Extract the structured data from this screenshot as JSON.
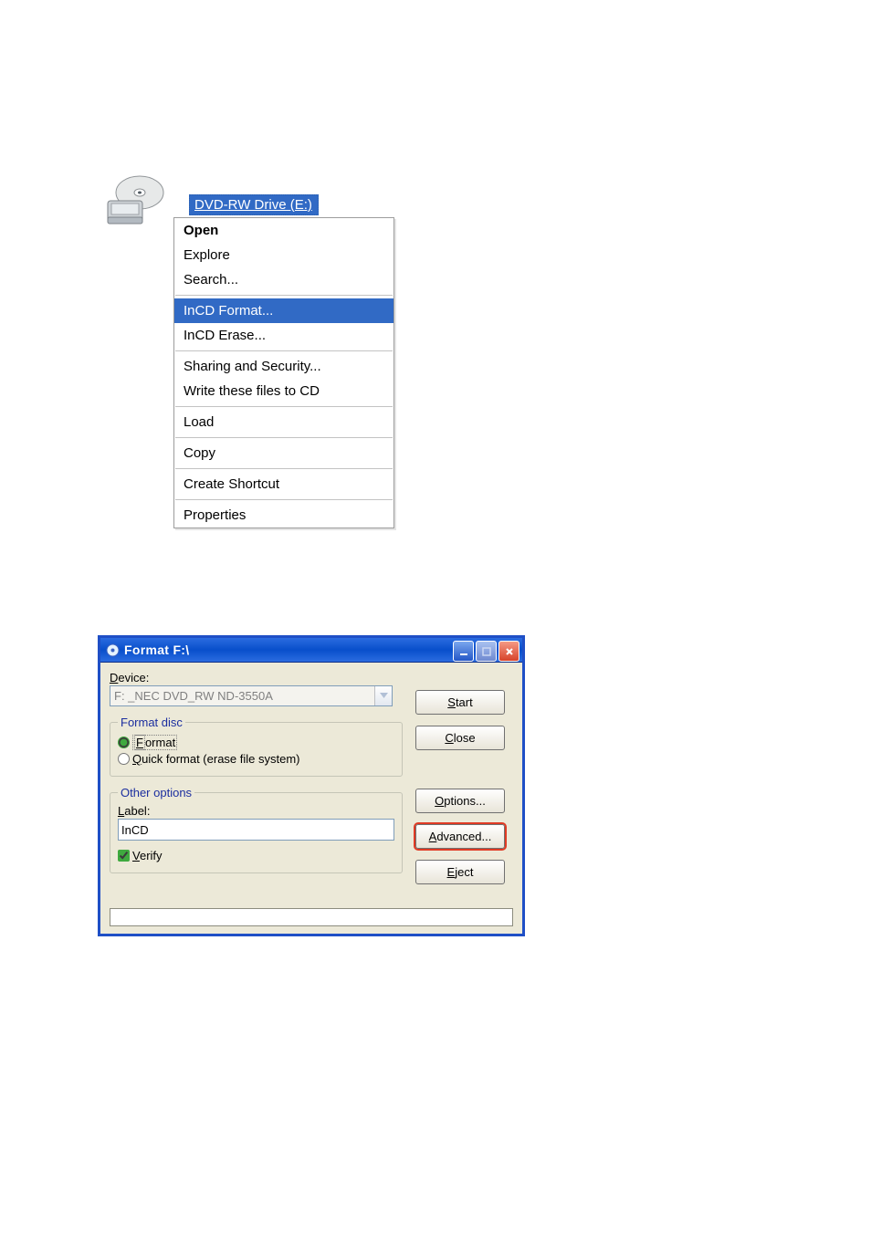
{
  "drive": {
    "title": "DVD-RW Drive (E:)"
  },
  "context_menu": {
    "items": [
      {
        "label": "Open",
        "kind": "bold"
      },
      {
        "label": "Explore"
      },
      {
        "label": "Search..."
      },
      {
        "kind": "sep"
      },
      {
        "label": "InCD Format...",
        "kind": "highlight"
      },
      {
        "label": "InCD Erase..."
      },
      {
        "kind": "sep"
      },
      {
        "label": "Sharing and Security..."
      },
      {
        "label": "Write these files to CD"
      },
      {
        "kind": "sep"
      },
      {
        "label": "Load"
      },
      {
        "kind": "sep"
      },
      {
        "label": "Copy"
      },
      {
        "kind": "sep"
      },
      {
        "label": "Create Shortcut"
      },
      {
        "kind": "sep"
      },
      {
        "label": "Properties"
      }
    ]
  },
  "dialog": {
    "title": "Format F:\\",
    "device_label": "Device:",
    "device_value": "F: _NEC DVD_RW ND-3550A",
    "format_disc": {
      "legend": "Format disc",
      "radio_format": "Format",
      "radio_quick": "Quick format (erase file system)"
    },
    "other_options": {
      "legend": "Other options",
      "label_label": "Label:",
      "label_value": "InCD",
      "verify_label": "Verify"
    },
    "buttons": {
      "start": "Start",
      "close": "Close",
      "options": "Options...",
      "advanced": "Advanced...",
      "eject": "Eject"
    }
  }
}
